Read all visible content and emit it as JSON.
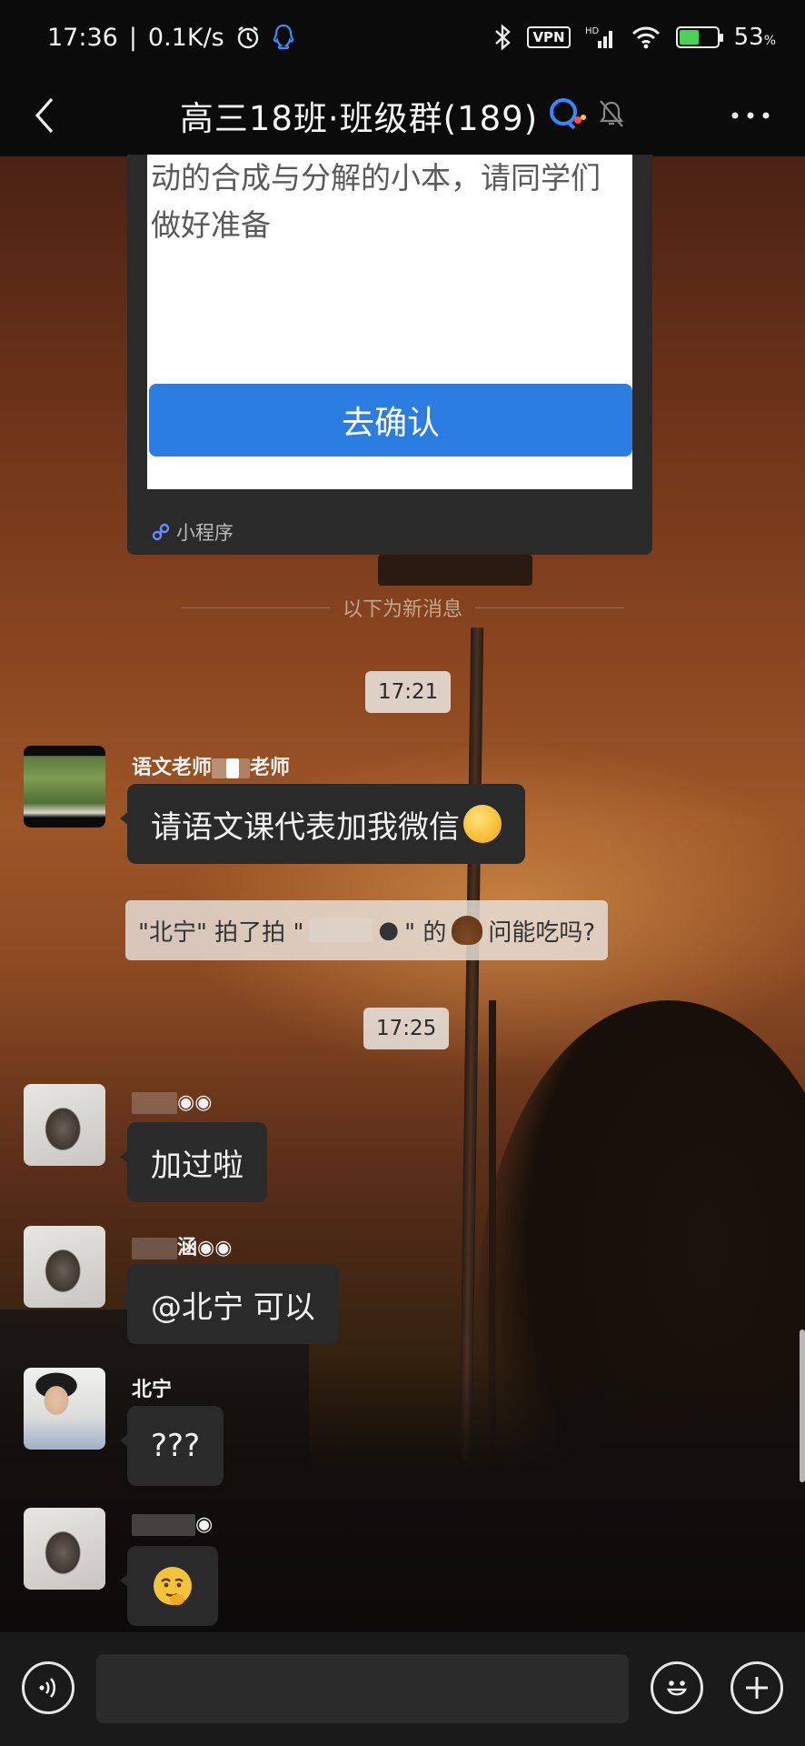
{
  "status_bar": {
    "time": "17:36",
    "speed": "0.1K/s",
    "vpn": "VPN",
    "hd": "HD",
    "battery_pct": "53",
    "battery_fill": 0.53
  },
  "header": {
    "title": "高三18班·班级群(189)"
  },
  "card": {
    "text": "动的合成与分解的小本，请同学们做好准备",
    "confirm_label": "去确认",
    "footer_label": "小程序"
  },
  "divider": {
    "label": "以下为新消息"
  },
  "timestamps": [
    "17:21",
    "17:25"
  ],
  "messages": [
    {
      "sender_prefix": "语文老师",
      "sender_suffix": "老师",
      "text": "请语文课代表加我微信"
    },
    {
      "sender_prefix": "",
      "sender_suffix": "",
      "text": "加过啦"
    },
    {
      "sender_prefix": "",
      "sender_suffix": "涵",
      "text": "@北宁  可以"
    },
    {
      "sender_prefix": "北宁",
      "sender_suffix": "",
      "text": "???"
    },
    {
      "sender_prefix": "",
      "sender_suffix": "",
      "text": ""
    }
  ],
  "system_note": {
    "part1": "\"北宁\" 拍了拍 \"",
    "part2": "\" 的",
    "part3": "问能吃吗?"
  },
  "input": {
    "placeholder": ""
  },
  "colors": {
    "accent_blue": "#2b7de1",
    "bubble": "#2a2a2a",
    "bar": "#0b0b0b"
  }
}
